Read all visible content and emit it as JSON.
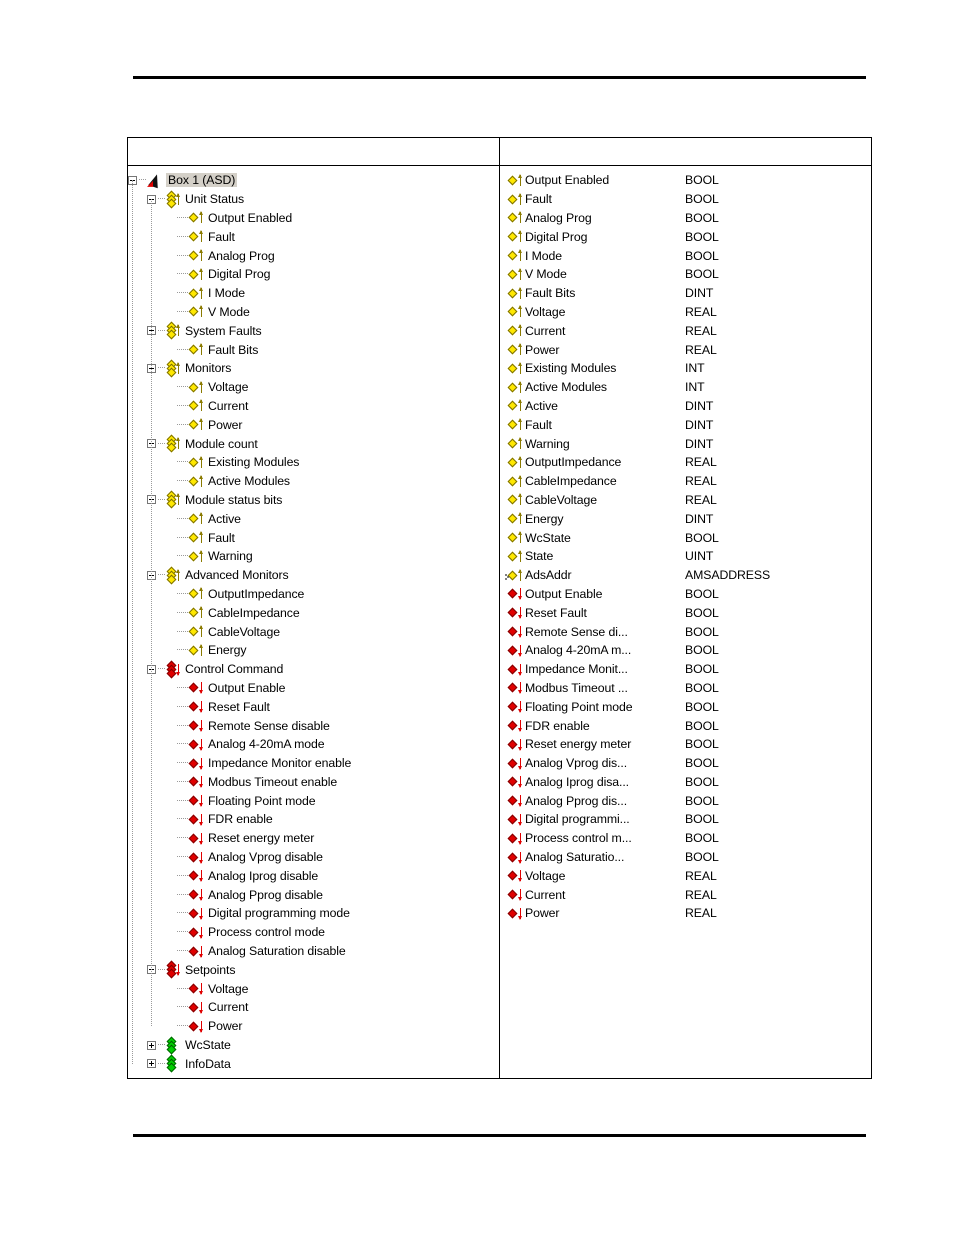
{
  "page": {
    "top_rule": true,
    "bottom_rule": true
  },
  "table": {
    "header_left": "",
    "header_right": "",
    "columns": [
      "",
      ""
    ]
  },
  "tree": {
    "name": "process-image-tree",
    "rows": [
      {
        "depth": 0,
        "label": "Box 1 (ASD)",
        "icon": "device",
        "arrow": "none",
        "expander": "minus",
        "selected": true
      },
      {
        "depth": 1,
        "label": "Unit Status",
        "icon": "group-yellow",
        "arrow": "in",
        "expander": "minus",
        "selected": false
      },
      {
        "depth": 2,
        "label": "Output Enabled",
        "icon": "var-yellow",
        "arrow": "in",
        "expander": "none",
        "selected": false
      },
      {
        "depth": 2,
        "label": "Fault",
        "icon": "var-yellow",
        "arrow": "in",
        "expander": "none",
        "selected": false
      },
      {
        "depth": 2,
        "label": "Analog Prog",
        "icon": "var-yellow",
        "arrow": "in",
        "expander": "none",
        "selected": false
      },
      {
        "depth": 2,
        "label": "Digital Prog",
        "icon": "var-yellow",
        "arrow": "in",
        "expander": "none",
        "selected": false
      },
      {
        "depth": 2,
        "label": "I Mode",
        "icon": "var-yellow",
        "arrow": "in",
        "expander": "none",
        "selected": false
      },
      {
        "depth": 2,
        "label": "V Mode",
        "icon": "var-yellow",
        "arrow": "in",
        "expander": "none",
        "selected": false
      },
      {
        "depth": 1,
        "label": "System Faults",
        "icon": "group-yellow",
        "arrow": "in",
        "expander": "minus",
        "selected": false
      },
      {
        "depth": 2,
        "label": "Fault Bits",
        "icon": "var-yellow",
        "arrow": "in",
        "expander": "none",
        "selected": false
      },
      {
        "depth": 1,
        "label": "Monitors",
        "icon": "group-yellow",
        "arrow": "in",
        "expander": "minus",
        "selected": false
      },
      {
        "depth": 2,
        "label": "Voltage",
        "icon": "var-yellow",
        "arrow": "in",
        "expander": "none",
        "selected": false
      },
      {
        "depth": 2,
        "label": "Current",
        "icon": "var-yellow",
        "arrow": "in",
        "expander": "none",
        "selected": false
      },
      {
        "depth": 2,
        "label": "Power",
        "icon": "var-yellow",
        "arrow": "in",
        "expander": "none",
        "selected": false
      },
      {
        "depth": 1,
        "label": "Module count",
        "icon": "group-yellow",
        "arrow": "in",
        "expander": "minus",
        "selected": false
      },
      {
        "depth": 2,
        "label": "Existing Modules",
        "icon": "var-yellow",
        "arrow": "in",
        "expander": "none",
        "selected": false
      },
      {
        "depth": 2,
        "label": "Active Modules",
        "icon": "var-yellow",
        "arrow": "in",
        "expander": "none",
        "selected": false
      },
      {
        "depth": 1,
        "label": "Module status bits",
        "icon": "group-yellow",
        "arrow": "in",
        "expander": "minus",
        "selected": false
      },
      {
        "depth": 2,
        "label": "Active",
        "icon": "var-yellow",
        "arrow": "in",
        "expander": "none",
        "selected": false
      },
      {
        "depth": 2,
        "label": "Fault",
        "icon": "var-yellow",
        "arrow": "in",
        "expander": "none",
        "selected": false
      },
      {
        "depth": 2,
        "label": "Warning",
        "icon": "var-yellow",
        "arrow": "in",
        "expander": "none",
        "selected": false
      },
      {
        "depth": 1,
        "label": "Advanced Monitors",
        "icon": "group-yellow",
        "arrow": "in",
        "expander": "minus",
        "selected": false
      },
      {
        "depth": 2,
        "label": "OutputImpedance",
        "icon": "var-yellow",
        "arrow": "in",
        "expander": "none",
        "selected": false
      },
      {
        "depth": 2,
        "label": "CableImpedance",
        "icon": "var-yellow",
        "arrow": "in",
        "expander": "none",
        "selected": false
      },
      {
        "depth": 2,
        "label": "CableVoltage",
        "icon": "var-yellow",
        "arrow": "in",
        "expander": "none",
        "selected": false
      },
      {
        "depth": 2,
        "label": "Energy",
        "icon": "var-yellow",
        "arrow": "in",
        "expander": "none",
        "selected": false
      },
      {
        "depth": 1,
        "label": "Control Command",
        "icon": "group-red",
        "arrow": "out",
        "expander": "minus",
        "selected": false
      },
      {
        "depth": 2,
        "label": "Output Enable",
        "icon": "var-red",
        "arrow": "out",
        "expander": "none",
        "selected": false
      },
      {
        "depth": 2,
        "label": "Reset Fault",
        "icon": "var-red",
        "arrow": "out",
        "expander": "none",
        "selected": false
      },
      {
        "depth": 2,
        "label": "Remote Sense disable",
        "icon": "var-red",
        "arrow": "out",
        "expander": "none",
        "selected": false
      },
      {
        "depth": 2,
        "label": "Analog 4-20mA mode",
        "icon": "var-red",
        "arrow": "out",
        "expander": "none",
        "selected": false
      },
      {
        "depth": 2,
        "label": "Impedance Monitor enable",
        "icon": "var-red",
        "arrow": "out",
        "expander": "none",
        "selected": false
      },
      {
        "depth": 2,
        "label": "Modbus Timeout enable",
        "icon": "var-red",
        "arrow": "out",
        "expander": "none",
        "selected": false
      },
      {
        "depth": 2,
        "label": "Floating Point mode",
        "icon": "var-red",
        "arrow": "out",
        "expander": "none",
        "selected": false
      },
      {
        "depth": 2,
        "label": "FDR enable",
        "icon": "var-red",
        "arrow": "out",
        "expander": "none",
        "selected": false
      },
      {
        "depth": 2,
        "label": "Reset energy meter",
        "icon": "var-red",
        "arrow": "out",
        "expander": "none",
        "selected": false
      },
      {
        "depth": 2,
        "label": "Analog Vprog disable",
        "icon": "var-red",
        "arrow": "out",
        "expander": "none",
        "selected": false
      },
      {
        "depth": 2,
        "label": "Analog Iprog disable",
        "icon": "var-red",
        "arrow": "out",
        "expander": "none",
        "selected": false
      },
      {
        "depth": 2,
        "label": "Analog Pprog disable",
        "icon": "var-red",
        "arrow": "out",
        "expander": "none",
        "selected": false
      },
      {
        "depth": 2,
        "label": "Digital programming mode",
        "icon": "var-red",
        "arrow": "out",
        "expander": "none",
        "selected": false
      },
      {
        "depth": 2,
        "label": "Process control mode",
        "icon": "var-red",
        "arrow": "out",
        "expander": "none",
        "selected": false
      },
      {
        "depth": 2,
        "label": "Analog Saturation disable",
        "icon": "var-red",
        "arrow": "out",
        "expander": "none",
        "selected": false
      },
      {
        "depth": 1,
        "label": "Setpoints",
        "icon": "group-red",
        "arrow": "out",
        "expander": "minus",
        "selected": false
      },
      {
        "depth": 2,
        "label": "Voltage",
        "icon": "var-red",
        "arrow": "out",
        "expander": "none",
        "selected": false
      },
      {
        "depth": 2,
        "label": "Current",
        "icon": "var-red",
        "arrow": "out",
        "expander": "none",
        "selected": false
      },
      {
        "depth": 2,
        "label": "Power",
        "icon": "var-red",
        "arrow": "out",
        "expander": "none",
        "selected": false
      },
      {
        "depth": 1,
        "label": "WcState",
        "icon": "group-green",
        "arrow": "none",
        "expander": "plus",
        "selected": false
      },
      {
        "depth": 1,
        "label": "InfoData",
        "icon": "group-green",
        "arrow": "none",
        "expander": "plus",
        "selected": false
      }
    ]
  },
  "process_image": {
    "name": "process-image-variable-list",
    "rows": [
      {
        "label": "Output Enabled",
        "type": "BOOL",
        "icon": "var-yellow",
        "arrow": "in"
      },
      {
        "label": "Fault",
        "type": "BOOL",
        "icon": "var-yellow",
        "arrow": "in"
      },
      {
        "label": "Analog Prog",
        "type": "BOOL",
        "icon": "var-yellow",
        "arrow": "in"
      },
      {
        "label": "Digital Prog",
        "type": "BOOL",
        "icon": "var-yellow",
        "arrow": "in"
      },
      {
        "label": "I Mode",
        "type": "BOOL",
        "icon": "var-yellow",
        "arrow": "in"
      },
      {
        "label": "V Mode",
        "type": "BOOL",
        "icon": "var-yellow",
        "arrow": "in"
      },
      {
        "label": "Fault Bits",
        "type": "DINT",
        "icon": "var-yellow",
        "arrow": "in"
      },
      {
        "label": "Voltage",
        "type": "REAL",
        "icon": "var-yellow",
        "arrow": "in"
      },
      {
        "label": "Current",
        "type": "REAL",
        "icon": "var-yellow",
        "arrow": "in"
      },
      {
        "label": "Power",
        "type": "REAL",
        "icon": "var-yellow",
        "arrow": "in"
      },
      {
        "label": "Existing Modules",
        "type": "INT",
        "icon": "var-yellow",
        "arrow": "in"
      },
      {
        "label": "Active Modules",
        "type": "INT",
        "icon": "var-yellow",
        "arrow": "in"
      },
      {
        "label": "Active",
        "type": "DINT",
        "icon": "var-yellow",
        "arrow": "in"
      },
      {
        "label": "Fault",
        "type": "DINT",
        "icon": "var-yellow",
        "arrow": "in"
      },
      {
        "label": "Warning",
        "type": "DINT",
        "icon": "var-yellow",
        "arrow": "in"
      },
      {
        "label": "OutputImpedance",
        "type": "REAL",
        "icon": "var-yellow",
        "arrow": "in"
      },
      {
        "label": "CableImpedance",
        "type": "REAL",
        "icon": "var-yellow",
        "arrow": "in"
      },
      {
        "label": "CableVoltage",
        "type": "REAL",
        "icon": "var-yellow",
        "arrow": "in"
      },
      {
        "label": "Energy",
        "type": "DINT",
        "icon": "var-yellow",
        "arrow": "in"
      },
      {
        "label": "WcState",
        "type": "BOOL",
        "icon": "var-yellow",
        "arrow": "in"
      },
      {
        "label": "State",
        "type": "UINT",
        "icon": "var-yellow",
        "arrow": "in"
      },
      {
        "label": "AdsAddr",
        "type": "AMSADDRESS",
        "icon": "var-yellow-ads",
        "arrow": "in"
      },
      {
        "label": "Output Enable",
        "type": "BOOL",
        "icon": "var-red",
        "arrow": "out"
      },
      {
        "label": "Reset Fault",
        "type": "BOOL",
        "icon": "var-red",
        "arrow": "out"
      },
      {
        "label": "Remote Sense di...",
        "type": "BOOL",
        "icon": "var-red",
        "arrow": "out"
      },
      {
        "label": "Analog 4-20mA m...",
        "type": "BOOL",
        "icon": "var-red",
        "arrow": "out"
      },
      {
        "label": "Impedance Monit...",
        "type": "BOOL",
        "icon": "var-red",
        "arrow": "out"
      },
      {
        "label": "Modbus Timeout ...",
        "type": "BOOL",
        "icon": "var-red",
        "arrow": "out"
      },
      {
        "label": "Floating Point mode",
        "type": "BOOL",
        "icon": "var-red",
        "arrow": "out"
      },
      {
        "label": "FDR enable",
        "type": "BOOL",
        "icon": "var-red",
        "arrow": "out"
      },
      {
        "label": "Reset energy meter",
        "type": "BOOL",
        "icon": "var-red",
        "arrow": "out"
      },
      {
        "label": "Analog Vprog dis...",
        "type": "BOOL",
        "icon": "var-red",
        "arrow": "out"
      },
      {
        "label": "Analog Iprog disa...",
        "type": "BOOL",
        "icon": "var-red",
        "arrow": "out"
      },
      {
        "label": "Analog Pprog dis...",
        "type": "BOOL",
        "icon": "var-red",
        "arrow": "out"
      },
      {
        "label": "Digital programmi...",
        "type": "BOOL",
        "icon": "var-red",
        "arrow": "out"
      },
      {
        "label": "Process control m...",
        "type": "BOOL",
        "icon": "var-red",
        "arrow": "out"
      },
      {
        "label": "Analog Saturatio...",
        "type": "BOOL",
        "icon": "var-red",
        "arrow": "out"
      },
      {
        "label": "Voltage",
        "type": "REAL",
        "icon": "var-red",
        "arrow": "out"
      },
      {
        "label": "Current",
        "type": "REAL",
        "icon": "var-red",
        "arrow": "out"
      },
      {
        "label": "Power",
        "type": "REAL",
        "icon": "var-red",
        "arrow": "out"
      }
    ]
  },
  "colors": {
    "input_yellow": "#ffe800",
    "output_red": "#e00000",
    "info_green": "#00d000",
    "selection": "#d4d0c8",
    "rule": "#000000"
  }
}
